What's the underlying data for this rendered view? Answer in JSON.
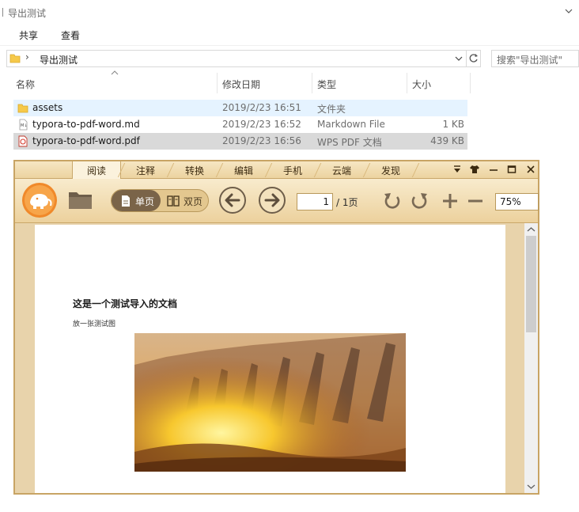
{
  "explorer": {
    "title": "导出测试",
    "ribbon_tabs": [
      "共享",
      "查看"
    ],
    "address_path": "导出测试",
    "search_placeholder": "搜索\"导出测试\"",
    "columns": [
      "名称",
      "修改日期",
      "类型",
      "大小"
    ],
    "files": [
      {
        "name": "assets",
        "date": "2019/2/23 16:51",
        "type": "文件夹",
        "size": "",
        "icon": "folder-icon"
      },
      {
        "name": "typora-to-pdf-word.md",
        "date": "2019/2/23 16:52",
        "type": "Markdown File",
        "size": "1 KB",
        "icon": "markdown-file-icon"
      },
      {
        "name": "typora-to-pdf-word.pdf",
        "date": "2019/2/23 16:56",
        "type": "WPS PDF 文档",
        "size": "439 KB",
        "icon": "pdf-file-icon"
      }
    ]
  },
  "viewer": {
    "menu_tabs": [
      "阅读",
      "注释",
      "转换",
      "编辑",
      "手机",
      "云端",
      "发现"
    ],
    "active_tab": "阅读",
    "toolbar": {
      "single_page_label": "单页",
      "double_page_label": "双页",
      "page_current": "1",
      "page_total": "/ 1页",
      "zoom": "75%"
    },
    "document": {
      "heading": "这是一个测试导入的文档",
      "paragraph": "放一张测试图"
    },
    "accent_color": "#c8a464"
  }
}
